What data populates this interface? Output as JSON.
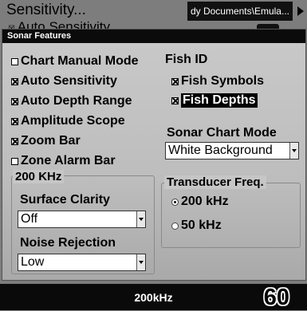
{
  "background": {
    "menu_item": "Sensitivity...",
    "menu_item_2": "Auto Sensitivity",
    "path_label": "dy Documents\\Emula..."
  },
  "dialog": {
    "title": "Sonar Features",
    "left_options": [
      {
        "label": "Chart Manual Mode",
        "checked": false
      },
      {
        "label": "Auto Sensitivity",
        "checked": true
      },
      {
        "label": "Auto Depth Range",
        "checked": true
      },
      {
        "label": "Amplitude Scope",
        "checked": true
      },
      {
        "label": "Zoom Bar",
        "checked": true
      },
      {
        "label": "Zone Alarm Bar",
        "checked": false
      }
    ],
    "fish_id": {
      "heading": "Fish ID",
      "options": [
        {
          "label": "Fish Symbols",
          "checked": true
        },
        {
          "label": "Fish Depths",
          "checked": true,
          "focused": true
        }
      ]
    },
    "sonar_chart_mode": {
      "heading": "Sonar Chart Mode",
      "value": "White Background"
    },
    "freq_group": {
      "label": "200 KHz",
      "surface_clarity": {
        "label": "Surface Clarity",
        "value": "Off"
      },
      "noise_rejection": {
        "label": "Noise Rejection",
        "value": "Low"
      }
    },
    "transducer": {
      "label": "Transducer Freq.",
      "options": [
        {
          "label": "200 kHz",
          "selected": true
        },
        {
          "label": "50 kHz",
          "selected": false
        }
      ]
    }
  },
  "status_bar": {
    "frequency": "200kHz",
    "depth": "60"
  }
}
